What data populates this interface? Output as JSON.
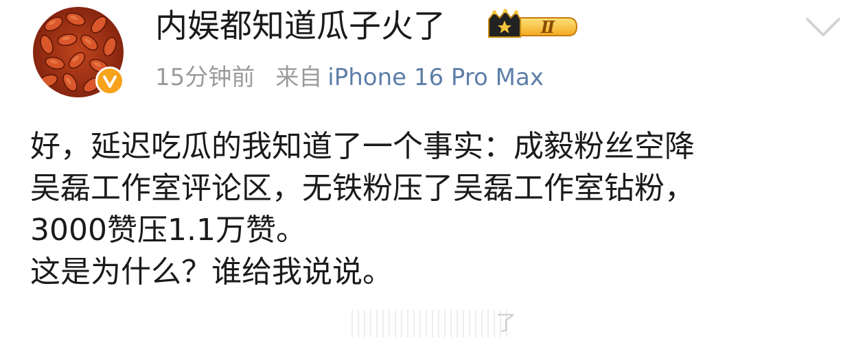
{
  "post": {
    "author": {
      "name": "内娱都知道瓜子火了",
      "level": "Ⅱ",
      "avatar_icon": "watermelon-seeds-avatar",
      "verified_badge_icon": "verified-v-icon",
      "verified_color": "#f7a21b"
    },
    "meta": {
      "time": "15分钟前",
      "source_prefix": "来自",
      "device": "iPhone 16 Pro Max"
    },
    "content": {
      "lines": [
        "好，延迟吃瓜的我知道了一个事实：成毅粉丝空降",
        "吴磊工作室评论区，无铁粉压了吴磊工作室钻粉，",
        "3000赞压1.1万赞。",
        "这是为什么？谁给我说说。"
      ]
    },
    "watermark": {
      "text": "了"
    },
    "colors": {
      "link": "#5d7ea8",
      "muted": "#9b9b9b",
      "text": "#1a1a1a"
    }
  }
}
